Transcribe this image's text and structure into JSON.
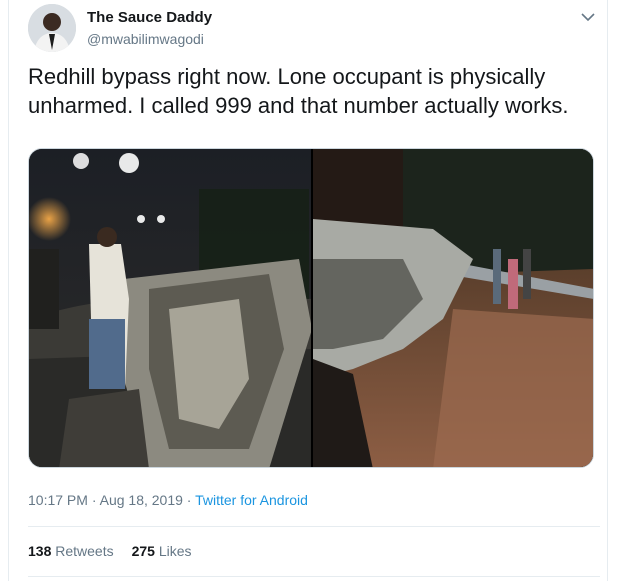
{
  "author": {
    "name": "The Sauce Daddy",
    "handle": "@mwabilimwagodi"
  },
  "tweet": {
    "text": "Redhill bypass right now. Lone occupant is physically\nunharmed. I called 999 and that number actually works."
  },
  "meta": {
    "time": "10:17 PM",
    "separator": " · ",
    "date": "Aug 18, 2019",
    "source": "Twitter for Android"
  },
  "stats": {
    "retweets_count": "138",
    "retweets_label": "Retweets",
    "likes_count": "275",
    "likes_label": "Likes"
  },
  "icons": {
    "menu": "chevron-down-icon"
  },
  "colors": {
    "text": "#14171a",
    "secondary": "#657786",
    "link": "#1b95e0",
    "border": "#e6ecf0"
  }
}
